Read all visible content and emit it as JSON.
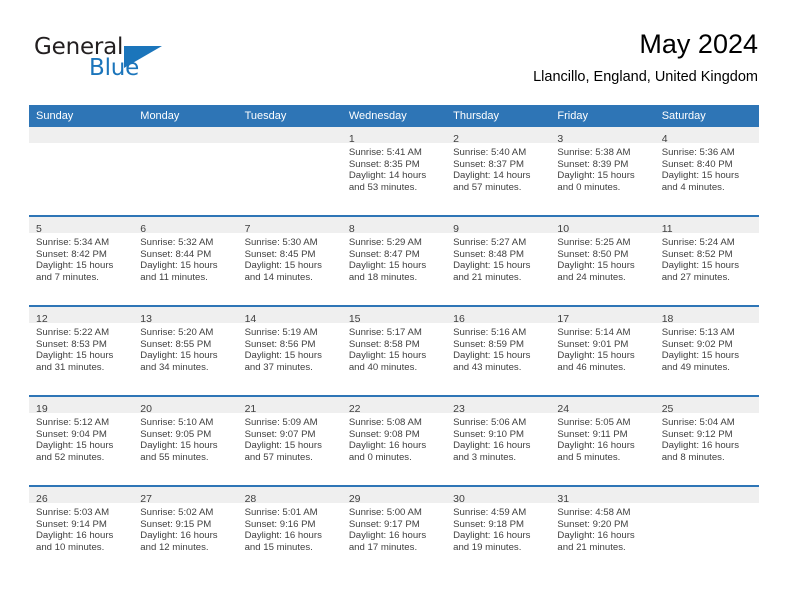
{
  "brand": {
    "name_part1": "General",
    "name_part2": "Blue",
    "accent_color": "#1b75bb"
  },
  "header": {
    "title": "May 2024",
    "subtitle": "Llancillo, England, United Kingdom"
  },
  "theme": {
    "header_row_bg": "#2e75b6",
    "daynum_strip_bg": "#efefef",
    "text_color": "#3f3f3f"
  },
  "weekday_headers": [
    "Sunday",
    "Monday",
    "Tuesday",
    "Wednesday",
    "Thursday",
    "Friday",
    "Saturday"
  ],
  "weeks": [
    [
      {
        "day": "",
        "empty": true
      },
      {
        "day": "",
        "empty": true
      },
      {
        "day": "",
        "empty": true
      },
      {
        "day": "1",
        "sunrise": "Sunrise: 5:41 AM",
        "sunset": "Sunset: 8:35 PM",
        "daylight1": "Daylight: 14 hours",
        "daylight2": "and 53 minutes."
      },
      {
        "day": "2",
        "sunrise": "Sunrise: 5:40 AM",
        "sunset": "Sunset: 8:37 PM",
        "daylight1": "Daylight: 14 hours",
        "daylight2": "and 57 minutes."
      },
      {
        "day": "3",
        "sunrise": "Sunrise: 5:38 AM",
        "sunset": "Sunset: 8:39 PM",
        "daylight1": "Daylight: 15 hours",
        "daylight2": "and 0 minutes."
      },
      {
        "day": "4",
        "sunrise": "Sunrise: 5:36 AM",
        "sunset": "Sunset: 8:40 PM",
        "daylight1": "Daylight: 15 hours",
        "daylight2": "and 4 minutes."
      }
    ],
    [
      {
        "day": "5",
        "sunrise": "Sunrise: 5:34 AM",
        "sunset": "Sunset: 8:42 PM",
        "daylight1": "Daylight: 15 hours",
        "daylight2": "and 7 minutes."
      },
      {
        "day": "6",
        "sunrise": "Sunrise: 5:32 AM",
        "sunset": "Sunset: 8:44 PM",
        "daylight1": "Daylight: 15 hours",
        "daylight2": "and 11 minutes."
      },
      {
        "day": "7",
        "sunrise": "Sunrise: 5:30 AM",
        "sunset": "Sunset: 8:45 PM",
        "daylight1": "Daylight: 15 hours",
        "daylight2": "and 14 minutes."
      },
      {
        "day": "8",
        "sunrise": "Sunrise: 5:29 AM",
        "sunset": "Sunset: 8:47 PM",
        "daylight1": "Daylight: 15 hours",
        "daylight2": "and 18 minutes."
      },
      {
        "day": "9",
        "sunrise": "Sunrise: 5:27 AM",
        "sunset": "Sunset: 8:48 PM",
        "daylight1": "Daylight: 15 hours",
        "daylight2": "and 21 minutes."
      },
      {
        "day": "10",
        "sunrise": "Sunrise: 5:25 AM",
        "sunset": "Sunset: 8:50 PM",
        "daylight1": "Daylight: 15 hours",
        "daylight2": "and 24 minutes."
      },
      {
        "day": "11",
        "sunrise": "Sunrise: 5:24 AM",
        "sunset": "Sunset: 8:52 PM",
        "daylight1": "Daylight: 15 hours",
        "daylight2": "and 27 minutes."
      }
    ],
    [
      {
        "day": "12",
        "sunrise": "Sunrise: 5:22 AM",
        "sunset": "Sunset: 8:53 PM",
        "daylight1": "Daylight: 15 hours",
        "daylight2": "and 31 minutes."
      },
      {
        "day": "13",
        "sunrise": "Sunrise: 5:20 AM",
        "sunset": "Sunset: 8:55 PM",
        "daylight1": "Daylight: 15 hours",
        "daylight2": "and 34 minutes."
      },
      {
        "day": "14",
        "sunrise": "Sunrise: 5:19 AM",
        "sunset": "Sunset: 8:56 PM",
        "daylight1": "Daylight: 15 hours",
        "daylight2": "and 37 minutes."
      },
      {
        "day": "15",
        "sunrise": "Sunrise: 5:17 AM",
        "sunset": "Sunset: 8:58 PM",
        "daylight1": "Daylight: 15 hours",
        "daylight2": "and 40 minutes."
      },
      {
        "day": "16",
        "sunrise": "Sunrise: 5:16 AM",
        "sunset": "Sunset: 8:59 PM",
        "daylight1": "Daylight: 15 hours",
        "daylight2": "and 43 minutes."
      },
      {
        "day": "17",
        "sunrise": "Sunrise: 5:14 AM",
        "sunset": "Sunset: 9:01 PM",
        "daylight1": "Daylight: 15 hours",
        "daylight2": "and 46 minutes."
      },
      {
        "day": "18",
        "sunrise": "Sunrise: 5:13 AM",
        "sunset": "Sunset: 9:02 PM",
        "daylight1": "Daylight: 15 hours",
        "daylight2": "and 49 minutes."
      }
    ],
    [
      {
        "day": "19",
        "sunrise": "Sunrise: 5:12 AM",
        "sunset": "Sunset: 9:04 PM",
        "daylight1": "Daylight: 15 hours",
        "daylight2": "and 52 minutes."
      },
      {
        "day": "20",
        "sunrise": "Sunrise: 5:10 AM",
        "sunset": "Sunset: 9:05 PM",
        "daylight1": "Daylight: 15 hours",
        "daylight2": "and 55 minutes."
      },
      {
        "day": "21",
        "sunrise": "Sunrise: 5:09 AM",
        "sunset": "Sunset: 9:07 PM",
        "daylight1": "Daylight: 15 hours",
        "daylight2": "and 57 minutes."
      },
      {
        "day": "22",
        "sunrise": "Sunrise: 5:08 AM",
        "sunset": "Sunset: 9:08 PM",
        "daylight1": "Daylight: 16 hours",
        "daylight2": "and 0 minutes."
      },
      {
        "day": "23",
        "sunrise": "Sunrise: 5:06 AM",
        "sunset": "Sunset: 9:10 PM",
        "daylight1": "Daylight: 16 hours",
        "daylight2": "and 3 minutes."
      },
      {
        "day": "24",
        "sunrise": "Sunrise: 5:05 AM",
        "sunset": "Sunset: 9:11 PM",
        "daylight1": "Daylight: 16 hours",
        "daylight2": "and 5 minutes."
      },
      {
        "day": "25",
        "sunrise": "Sunrise: 5:04 AM",
        "sunset": "Sunset: 9:12 PM",
        "daylight1": "Daylight: 16 hours",
        "daylight2": "and 8 minutes."
      }
    ],
    [
      {
        "day": "26",
        "sunrise": "Sunrise: 5:03 AM",
        "sunset": "Sunset: 9:14 PM",
        "daylight1": "Daylight: 16 hours",
        "daylight2": "and 10 minutes."
      },
      {
        "day": "27",
        "sunrise": "Sunrise: 5:02 AM",
        "sunset": "Sunset: 9:15 PM",
        "daylight1": "Daylight: 16 hours",
        "daylight2": "and 12 minutes."
      },
      {
        "day": "28",
        "sunrise": "Sunrise: 5:01 AM",
        "sunset": "Sunset: 9:16 PM",
        "daylight1": "Daylight: 16 hours",
        "daylight2": "and 15 minutes."
      },
      {
        "day": "29",
        "sunrise": "Sunrise: 5:00 AM",
        "sunset": "Sunset: 9:17 PM",
        "daylight1": "Daylight: 16 hours",
        "daylight2": "and 17 minutes."
      },
      {
        "day": "30",
        "sunrise": "Sunrise: 4:59 AM",
        "sunset": "Sunset: 9:18 PM",
        "daylight1": "Daylight: 16 hours",
        "daylight2": "and 19 minutes."
      },
      {
        "day": "31",
        "sunrise": "Sunrise: 4:58 AM",
        "sunset": "Sunset: 9:20 PM",
        "daylight1": "Daylight: 16 hours",
        "daylight2": "and 21 minutes."
      },
      {
        "day": "",
        "empty": true
      }
    ]
  ]
}
